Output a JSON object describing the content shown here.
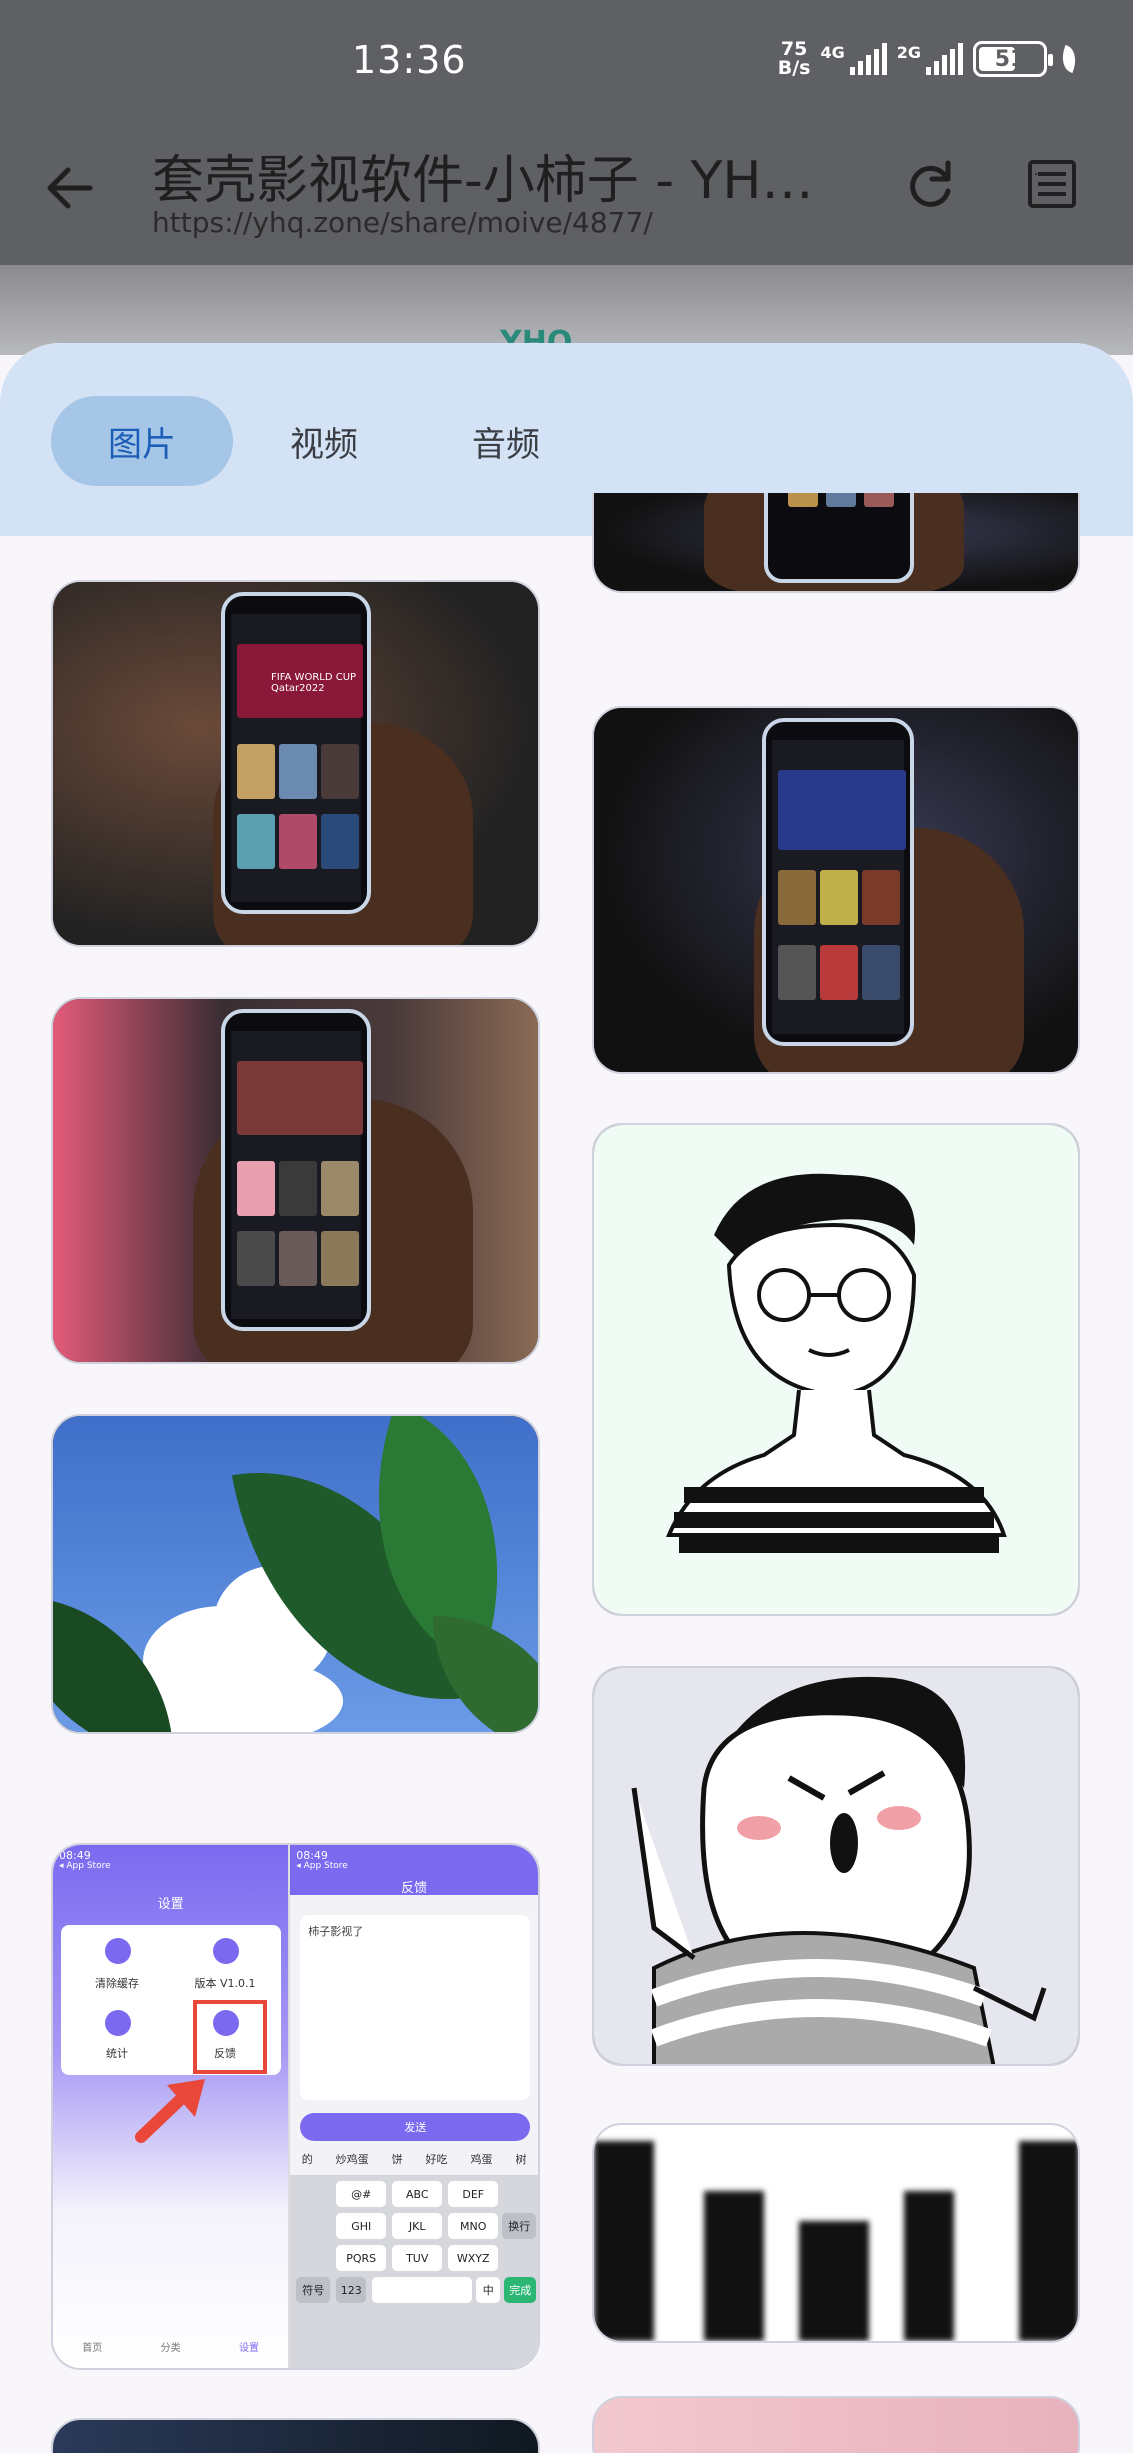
{
  "status_bar": {
    "time": "13:36",
    "net_speed_value": "75",
    "net_speed_unit": "B/s",
    "sim1_gen": "4G",
    "sim2_gen": "2G",
    "battery": "51"
  },
  "browser": {
    "title": "套壳影视软件-小柿子 - YH…",
    "url": "https://yhq.zone/share/moive/4877/"
  },
  "underlying_page": {
    "logo": "YHQ"
  },
  "media_picker": {
    "tabs": [
      {
        "label": "图片",
        "active": true
      },
      {
        "label": "视频",
        "active": false
      },
      {
        "label": "音频",
        "active": false
      }
    ]
  },
  "thumbs": {
    "t1_badge": "FIFA WORLD CUP Qatar2022",
    "settings": {
      "left_time": "08:49",
      "right_time": "08:49",
      "left_back": "◂ App Store",
      "right_back": "◂ App Store",
      "left_title": "设置",
      "right_title": "反馈",
      "item1": "清除缓存",
      "item2": "版本 V1.0.1",
      "item3": "统计",
      "item4": "反馈",
      "feedback_text": "柿子影视了",
      "send_button": "发送",
      "suggestions": [
        "的",
        "炒鸡蛋",
        "饼",
        "好吃",
        "鸡蛋",
        "树"
      ],
      "keys_row1": [
        "@#",
        "ABC",
        "DEF"
      ],
      "keys_row2": [
        "GHI",
        "JKL",
        "MNO"
      ],
      "keys_row3": [
        "PQRS",
        "TUV",
        "WXYZ"
      ],
      "key_symbols": "符号",
      "key_123": "123",
      "key_zh": "中",
      "key_done": "完成",
      "key_enter": "换行",
      "nav_items": [
        "首页",
        "分类",
        "设置"
      ]
    }
  },
  "colors": {
    "tab_bar_bg": "#d3e3f5",
    "tab_active_bg": "#a6c6e8",
    "tab_active_text": "#1d5fb8",
    "status_overlay": "#5f6064"
  }
}
